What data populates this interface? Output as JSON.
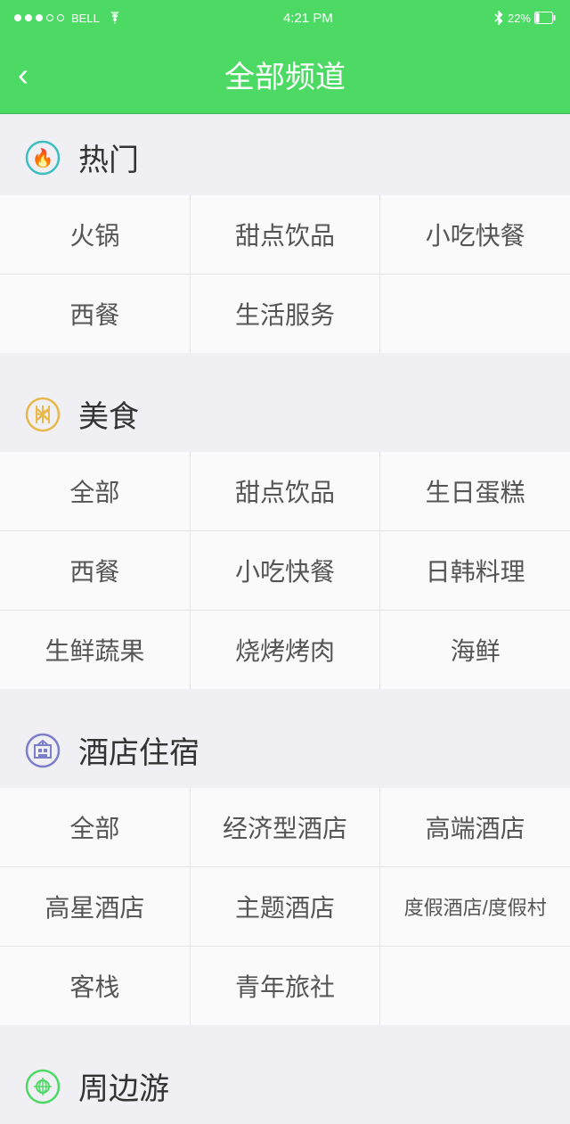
{
  "statusBar": {
    "carrier": "BELL",
    "time": "4:21 PM",
    "battery": "22%",
    "wifi": true,
    "bluetooth": true
  },
  "navBar": {
    "title": "全部频道",
    "backLabel": "<"
  },
  "sections": [
    {
      "id": "hot",
      "title": "热门",
      "iconType": "fire",
      "rows": [
        [
          "火锅",
          "甜点饮品",
          "小吃快餐"
        ],
        [
          "西餐",
          "生活服务",
          ""
        ]
      ]
    },
    {
      "id": "food",
      "title": "美食",
      "iconType": "fork",
      "rows": [
        [
          "全部",
          "甜点饮品",
          "生日蛋糕"
        ],
        [
          "西餐",
          "小吃快餐",
          "日韩料理"
        ],
        [
          "生鲜蔬果",
          "烧烤烤肉",
          "海鲜"
        ]
      ]
    },
    {
      "id": "hotel",
      "title": "酒店住宿",
      "iconType": "hotel",
      "rows": [
        [
          "全部",
          "经济型酒店",
          "高端酒店"
        ],
        [
          "高星酒店",
          "主题酒店",
          "度假酒店/度假村"
        ],
        [
          "客栈",
          "青年旅社",
          ""
        ]
      ]
    },
    {
      "id": "travel",
      "title": "周边游",
      "iconType": "travel",
      "rows": []
    }
  ]
}
